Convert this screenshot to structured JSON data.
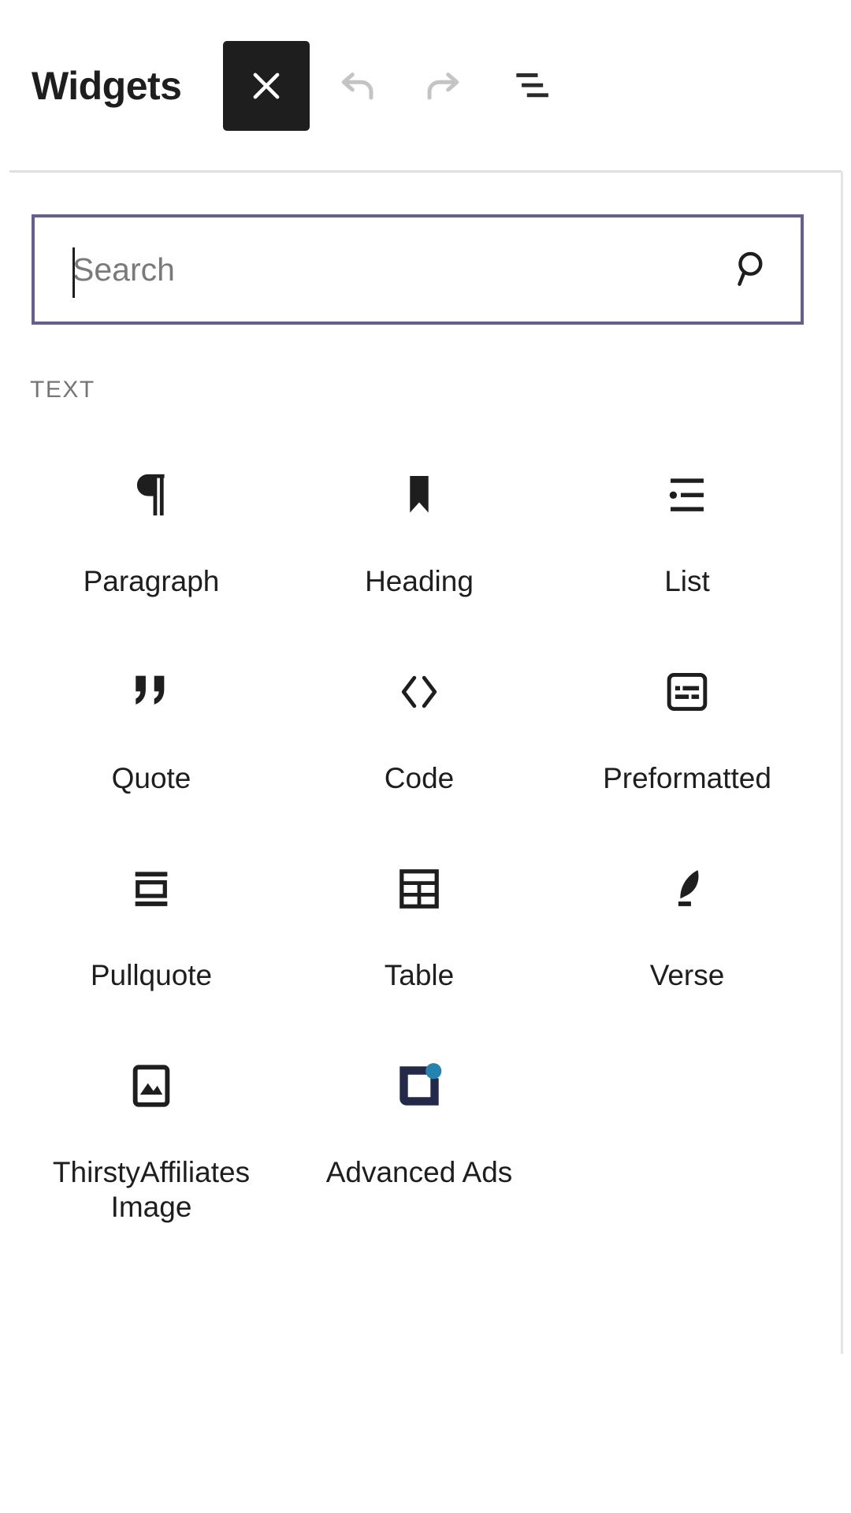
{
  "header": {
    "title": "Widgets",
    "close_label": "Close block inserter",
    "close_icon": "close-x-icon",
    "undo_label": "Undo",
    "undo_icon": "undo-arrow-icon",
    "redo_label": "Redo",
    "redo_icon": "redo-arrow-icon",
    "list_view_label": "List View",
    "list_view_icon": "list-view-icon"
  },
  "search": {
    "value": "",
    "placeholder": "Search",
    "icon": "search-magnifier-icon",
    "border_color": "#675e8a"
  },
  "categories": [
    {
      "label": "TEXT",
      "blocks": [
        {
          "label": "Paragraph",
          "icon": "paragraph-pilcrow-icon"
        },
        {
          "label": "Heading",
          "icon": "heading-bookmark-icon"
        },
        {
          "label": "List",
          "icon": "list-bullet-icon"
        },
        {
          "label": "Quote",
          "icon": "quote-marks-icon"
        },
        {
          "label": "Code",
          "icon": "code-angle-brackets-icon"
        },
        {
          "label": "Preformatted",
          "icon": "preformatted-box-icon"
        },
        {
          "label": "Pullquote",
          "icon": "pullquote-box-icon"
        },
        {
          "label": "Table",
          "icon": "table-grid-icon"
        },
        {
          "label": "Verse",
          "icon": "verse-feather-icon"
        },
        {
          "label": "ThirstyAffiliates Image",
          "icon": "image-placeholder-icon"
        },
        {
          "label": "Advanced Ads",
          "icon": "advanced-ads-logo-icon"
        }
      ]
    }
  ],
  "colors": {
    "accent_purple": "#675e8a",
    "close_button_bg": "#1e1e1e",
    "advanced_ads_navy": "#252949",
    "advanced_ads_blue": "#2583ad",
    "muted_text": "#757575"
  }
}
